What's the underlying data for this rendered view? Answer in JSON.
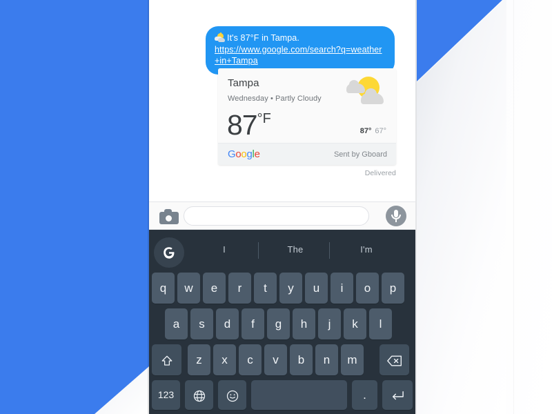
{
  "theme": {
    "bubble_blue": "#2196f3",
    "sheet_blue": "#3b7ced",
    "keyboard_bg": "#28323c",
    "key_bg": "#4d5c6b",
    "google_blue": "#4285f4",
    "google_red": "#ea4335",
    "google_yellow": "#fbbc05",
    "google_green": "#34a853"
  },
  "conversation": {
    "message": {
      "emoji_name": "sun-behind-cloud-emoji",
      "text": "It's 87°F in Tampa.",
      "link": "https://www.google.com/search?q=weather+in+Tampa"
    },
    "weather_card": {
      "city": "Tampa",
      "subtitle": "Wednesday • Partly Cloudy",
      "temperature": "87",
      "unit": "°F",
      "high": "87°",
      "low": "67°",
      "icon_name": "partly-cloudy-icon",
      "logo_letters": [
        "G",
        "o",
        "o",
        "g",
        "l",
        "e"
      ],
      "sent_by": "Sent by Gboard"
    },
    "status": "Delivered"
  },
  "input_bar": {
    "camera_icon": "camera-icon",
    "field_value": "",
    "field_placeholder": "",
    "mic_icon": "microphone-icon"
  },
  "keyboard": {
    "logo_button": "google-g-button",
    "suggestions": [
      "I",
      "The",
      "I'm"
    ],
    "rows": [
      [
        "q",
        "w",
        "e",
        "r",
        "t",
        "y",
        "u",
        "i",
        "o",
        "p"
      ],
      [
        "a",
        "s",
        "d",
        "f",
        "g",
        "h",
        "j",
        "k",
        "l"
      ],
      [
        "z",
        "x",
        "c",
        "v",
        "b",
        "n",
        "m"
      ]
    ],
    "shift_key": "shift-key",
    "backspace_key": "backspace-key",
    "bottom_row": {
      "numbers": "123",
      "globe": "language-globe-key",
      "emoji": "emoji-key",
      "space": "",
      "period": ".",
      "enter": "enter-key"
    }
  }
}
